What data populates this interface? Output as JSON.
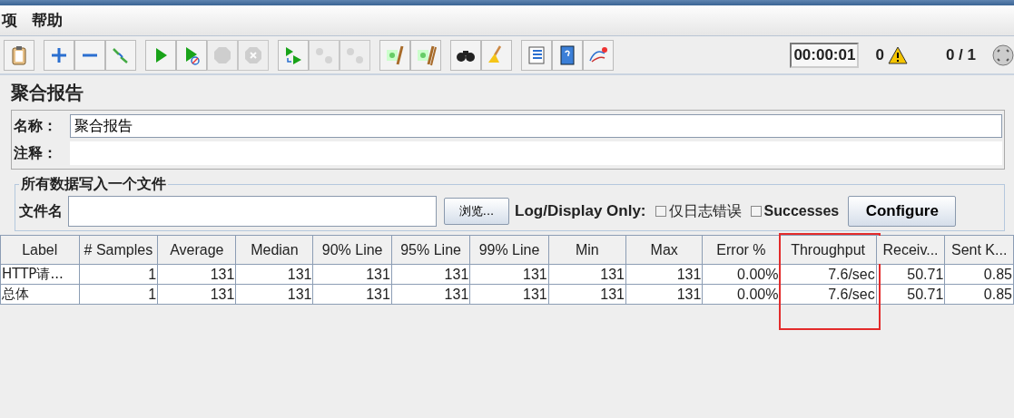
{
  "menu": [
    {
      "label": "项"
    },
    {
      "label": "帮助"
    }
  ],
  "toolbar": [
    [
      {
        "kind": "clipboard",
        "disabled": false
      }
    ],
    [
      {
        "kind": "add",
        "disabled": false
      },
      {
        "kind": "remove",
        "disabled": false
      },
      {
        "kind": "toggle",
        "disabled": false
      }
    ],
    [
      {
        "kind": "start",
        "disabled": false
      },
      {
        "kind": "start-no-timer",
        "disabled": false
      },
      {
        "kind": "stop",
        "disabled": true
      },
      {
        "kind": "shutdown",
        "disabled": true
      }
    ],
    [
      {
        "kind": "remote-start",
        "disabled": false
      },
      {
        "kind": "remote-stop",
        "disabled": true
      },
      {
        "kind": "remote-shutdown",
        "disabled": true
      }
    ],
    [
      {
        "kind": "clear",
        "disabled": false
      },
      {
        "kind": "clear-all",
        "disabled": false
      }
    ],
    [
      {
        "kind": "search",
        "disabled": false
      },
      {
        "kind": "reset-search",
        "disabled": false
      }
    ],
    [
      {
        "kind": "function-list",
        "disabled": false
      },
      {
        "kind": "help",
        "disabled": false
      },
      {
        "kind": "log",
        "disabled": false
      }
    ]
  ],
  "status": {
    "timer": "00:00:01",
    "warnings": "0",
    "threads": "0 / 1"
  },
  "panel": {
    "title": "聚合报告",
    "name_label": "名称：",
    "name_value": "聚合报告",
    "comment_label": "注释：",
    "file_group": {
      "title": "所有数据写入一个文件",
      "file_label": "文件名",
      "browse": "浏览...",
      "log_label": "Log/Display Only:",
      "checkboxes": [
        {
          "label": "仅日志错误",
          "checked": false
        },
        {
          "label": "Successes",
          "checked": false
        }
      ],
      "configure": "Configure"
    }
  },
  "table": {
    "columns": [
      {
        "label": "Label",
        "highlighted": false
      },
      {
        "label": "# Samples",
        "highlighted": false
      },
      {
        "label": "Average",
        "highlighted": false
      },
      {
        "label": "Median",
        "highlighted": false
      },
      {
        "label": "90% Line",
        "highlighted": false
      },
      {
        "label": "95% Line",
        "highlighted": false
      },
      {
        "label": "99% Line",
        "highlighted": false
      },
      {
        "label": "Min",
        "highlighted": false
      },
      {
        "label": "Max",
        "highlighted": false
      },
      {
        "label": "Error %",
        "highlighted": false
      },
      {
        "label": "Throughput",
        "highlighted": true
      },
      {
        "label": "Receiv...",
        "highlighted": false
      },
      {
        "label": "Sent K...",
        "highlighted": false
      }
    ],
    "rows": [
      [
        "HTTP请...",
        "1",
        "131",
        "131",
        "131",
        "131",
        "131",
        "131",
        "131",
        "0.00%",
        "7.6/sec",
        "50.71",
        "0.85"
      ],
      [
        "总体",
        "1",
        "131",
        "131",
        "131",
        "131",
        "131",
        "131",
        "131",
        "0.00%",
        "7.6/sec",
        "50.71",
        "0.85"
      ]
    ]
  }
}
